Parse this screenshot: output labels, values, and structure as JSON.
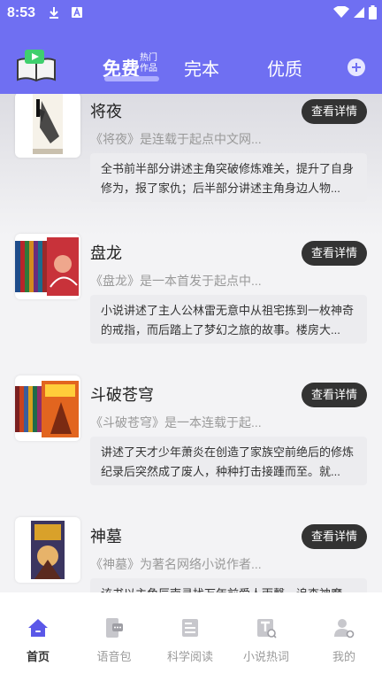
{
  "statusbar": {
    "time": "8:53"
  },
  "header": {
    "tabs": [
      {
        "label": "免费",
        "badge": "热门作品"
      },
      {
        "label": "完本"
      },
      {
        "label": "优质"
      }
    ]
  },
  "books": [
    {
      "title": "将夜",
      "subtitle": "《将夜》是连载于起点中文网...",
      "description": "全书前半部分讲述主角突破修炼难关，提升了自身修为，报了家仇；后半部分讲述主角身边人物...",
      "button": "查看详情"
    },
    {
      "title": "盘龙",
      "subtitle": "《盘龙》是一本首发于起点中...",
      "description": "小说讲述了主人公林雷无意中从祖宅拣到一枚神奇的戒指，而后踏上了梦幻之旅的故事。楼房大...",
      "button": "查看详情"
    },
    {
      "title": "斗破苍穹",
      "subtitle": "《斗破苍穹》是一本连载于起...",
      "description": "讲述了天才少年萧炎在创造了家族空前绝后的修炼纪录后突然成了废人，种种打击接踵而至。就...",
      "button": "查看详情"
    },
    {
      "title": "神墓",
      "subtitle": "《神墓》为著名网络小说作者...",
      "description": "该书以主角辰南寻找万年前爱人雨馨，追查神魔...",
      "button": "查看详情"
    }
  ],
  "nav": [
    {
      "label": "首页",
      "icon": "home-icon"
    },
    {
      "label": "语音包",
      "icon": "phone-chat-icon"
    },
    {
      "label": "科学阅读",
      "icon": "document-icon"
    },
    {
      "label": "小说热词",
      "icon": "text-search-icon"
    },
    {
      "label": "我的",
      "icon": "user-settings-icon"
    }
  ],
  "colors": {
    "header": "#6f6ff2",
    "active_nav": "#5a57e8",
    "inactive_nav": "#c7c7cc"
  }
}
